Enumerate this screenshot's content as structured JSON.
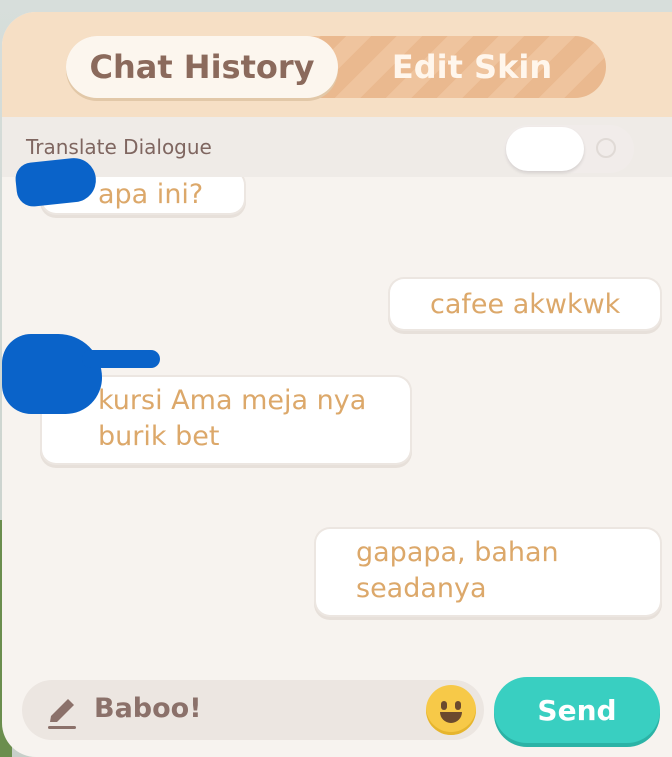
{
  "tabs": {
    "chat_history": "Chat History",
    "edit_skin": "Edit Skin"
  },
  "translate": {
    "label": "Translate Dialogue",
    "enabled": false
  },
  "messages": [
    {
      "side": "left",
      "text": "apa ini?"
    },
    {
      "side": "right",
      "text": "cafee akwkwk"
    },
    {
      "side": "left",
      "text": "kursi Ama meja nya\nburik bet"
    },
    {
      "side": "right",
      "text": "gapapa, bahan\nseadanya"
    }
  ],
  "input": {
    "value": "Baboo!"
  },
  "send_label": "Send",
  "icons": {
    "edit": "pencil-icon",
    "emoji": "smiley-emoji-icon"
  },
  "colors": {
    "header": "#f6dfc5",
    "tab_active_text": "#8b6a5c",
    "bubble_text": "#dca86a",
    "send_button": "#39cfc1",
    "redaction": "#0a63c9"
  }
}
